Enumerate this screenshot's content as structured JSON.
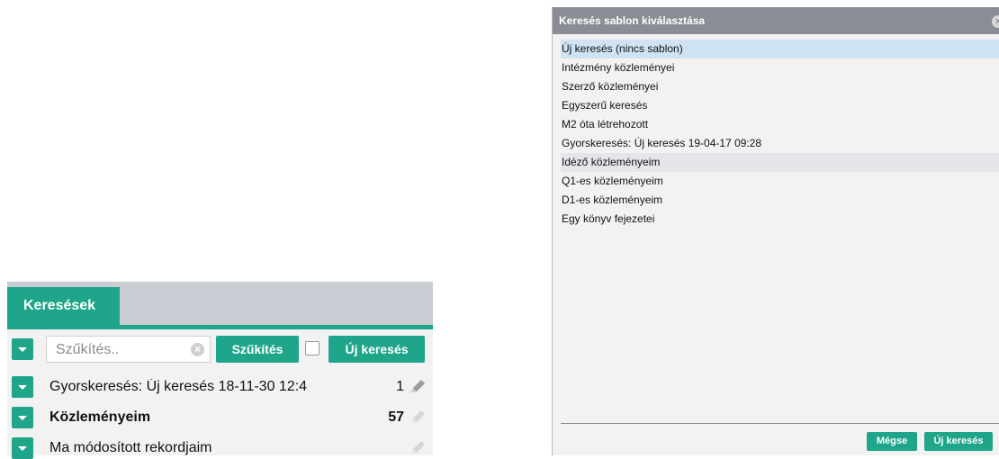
{
  "left_panel": {
    "tab_label": "Keresések",
    "search": {
      "placeholder": "Szűkítés..",
      "value": ""
    },
    "narrow_button": "Szűkítés",
    "new_search_button": "Új keresés",
    "rows": [
      {
        "label": "Gyorskeresés: Új keresés 18-11-30 12:4",
        "count": "1",
        "bold": false
      },
      {
        "label": "Közleményeim",
        "count": "57",
        "bold": true
      },
      {
        "label": "Ma módosított rekordjaim",
        "count": "",
        "bold": false
      }
    ]
  },
  "dialog": {
    "title": "Keresés sablon kiválasztása",
    "items": [
      "Új keresés (nincs sablon)",
      "Intézmény közleményei",
      "Szerző közleményei",
      "Egyszerű keresés",
      "M2 óta létrehozott",
      "Gyorskeresés: Új keresés 19-04-17 09:28",
      "Idéző közleményeim",
      "Q1-es közleményeim",
      "D1-es közleményeim",
      "Egy könyv fejezetei"
    ],
    "selected_index": 0,
    "highlighted_index": 6,
    "cancel_button": "Mégse",
    "ok_button": "Új keresés"
  },
  "colors": {
    "accent": "#1ea58a",
    "dialog_header": "#8a8d96",
    "selected_row": "#cfe3f2"
  },
  "icons": [
    "chevron-down-icon",
    "clear-icon",
    "checkbox",
    "pencil-icon",
    "close-icon"
  ]
}
